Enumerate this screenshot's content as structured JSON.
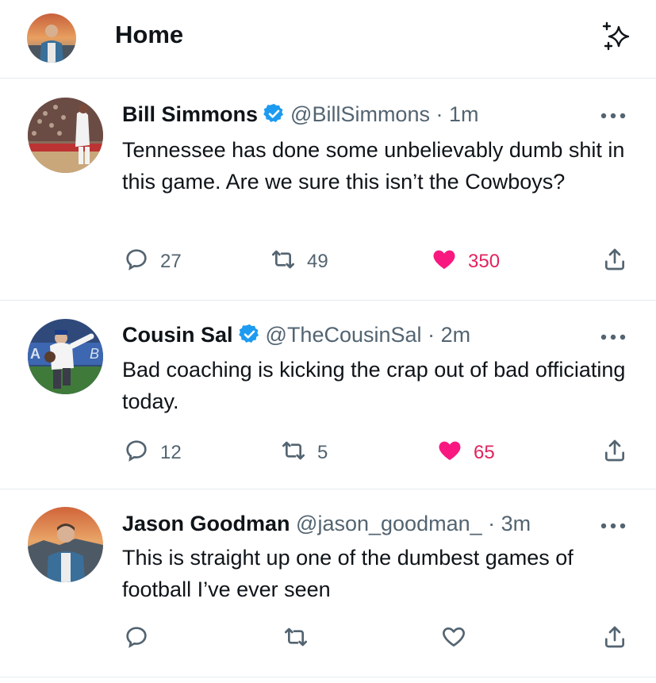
{
  "header": {
    "title": "Home",
    "sparkle_icon": "sparkle-icon"
  },
  "colors": {
    "like": "#f91880",
    "verified": "#1d9bf0",
    "secondary": "#536471"
  },
  "tweets": [
    {
      "name": "Bill Simmons",
      "verified": true,
      "handle": "@BillSimmons",
      "separator": "·",
      "time": "1m",
      "text": "Tennessee has done some unbelievably dumb shit in this game. Are we sure this isn’t the Cowboys?",
      "replies": "27",
      "retweets": "49",
      "likes": "350",
      "liked": true
    },
    {
      "name": "Cousin Sal",
      "verified": true,
      "handle": "@TheCousinSal",
      "separator": "·",
      "time": "2m",
      "text": "Bad coaching is kicking the crap out of bad officiating today.",
      "replies": "12",
      "retweets": "5",
      "likes": "65",
      "liked": true
    },
    {
      "name": "Jason Goodman",
      "verified": false,
      "handle": "@jason_goodman_",
      "separator": "·",
      "time": "3m",
      "text": "This is straight up one of the dumbest games of football I’ve ever seen",
      "replies": "",
      "retweets": "",
      "likes": "",
      "liked": false
    }
  ]
}
